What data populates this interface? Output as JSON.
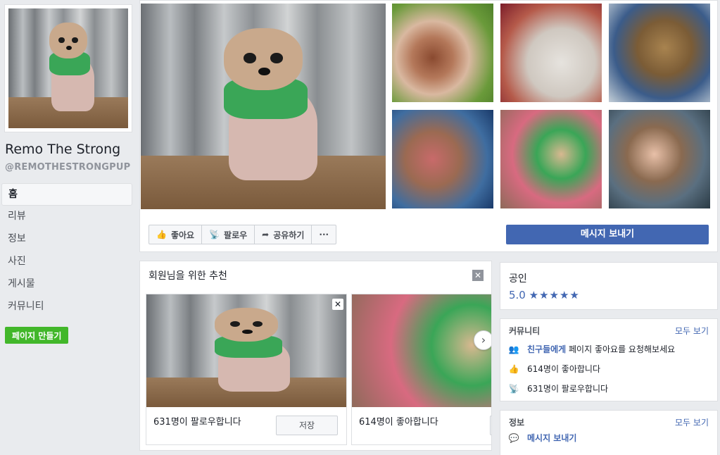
{
  "sidebar": {
    "page_name": "Remo The Strong",
    "handle": "@REMOTHESTRONGPUP",
    "nav": [
      "홈",
      "리뷰",
      "정보",
      "사진",
      "게시물",
      "커뮤니티"
    ],
    "create_page": "페이지 만들기"
  },
  "actions": {
    "like": "좋아요",
    "follow": "팔로우",
    "share": "공유하기",
    "more": "···",
    "message": "메시지 보내기"
  },
  "recommend": {
    "title": "회원님을 위한 추천",
    "items": [
      {
        "text": "631명이 팔로우합니다",
        "button": "저장"
      },
      {
        "text": "614명이 좋아합니다"
      }
    ]
  },
  "official": {
    "label": "공인",
    "rating": "5.0",
    "stars": "★★★★★"
  },
  "community": {
    "title": "커뮤니티",
    "see_all": "모두 보기",
    "invite_link": "친구들에게",
    "invite_rest": " 페이지 좋아요를 요청해보세요",
    "likes": "614명이 좋아합니다",
    "follows": "631명이 팔로우합니다"
  },
  "info": {
    "title": "정보",
    "see_all": "모두 보기",
    "message": "메시지 보내기"
  },
  "colors": {
    "brand": "#4267b2",
    "green": "#42b72a"
  }
}
